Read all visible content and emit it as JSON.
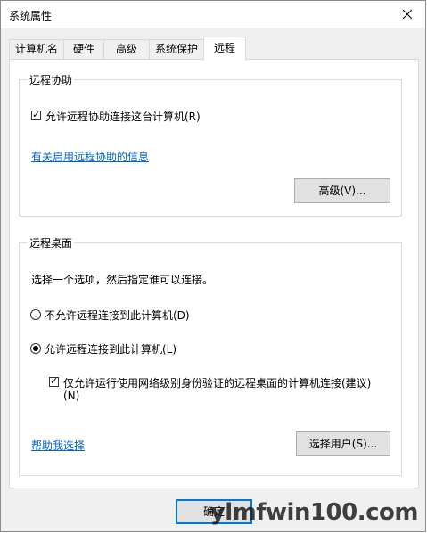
{
  "window": {
    "title": "系统属性"
  },
  "tabs": [
    {
      "label": "计算机名",
      "active": false
    },
    {
      "label": "硬件",
      "active": false
    },
    {
      "label": "高级",
      "active": false
    },
    {
      "label": "系统保护",
      "active": false
    },
    {
      "label": "远程",
      "active": true
    }
  ],
  "remote_assistance": {
    "group_title": "远程协助",
    "allow_checkbox_label": "允许远程协助连接这台计算机(R)",
    "allow_checked": true,
    "info_link": "有关启用远程协助的信息",
    "advanced_button": "高级(V)..."
  },
  "remote_desktop": {
    "group_title": "远程桌面",
    "description": "选择一个选项，然后指定谁可以连接。",
    "option_disallow": "不允许远程连接到此计算机(D)",
    "option_allow": "允许远程连接到此计算机(L)",
    "selected_option": "allow",
    "nla_checkbox_label_line1": "仅允许运行使用网络级别身份验证的远程桌面的计算机连接(建议)",
    "nla_checkbox_label_line2": "(N)",
    "nla_checked": true,
    "help_link": "帮助我选择",
    "select_users_button": "选择用户(S)..."
  },
  "footer": {
    "ok_button": "确定"
  },
  "watermark": "ylmfwin100.com"
}
